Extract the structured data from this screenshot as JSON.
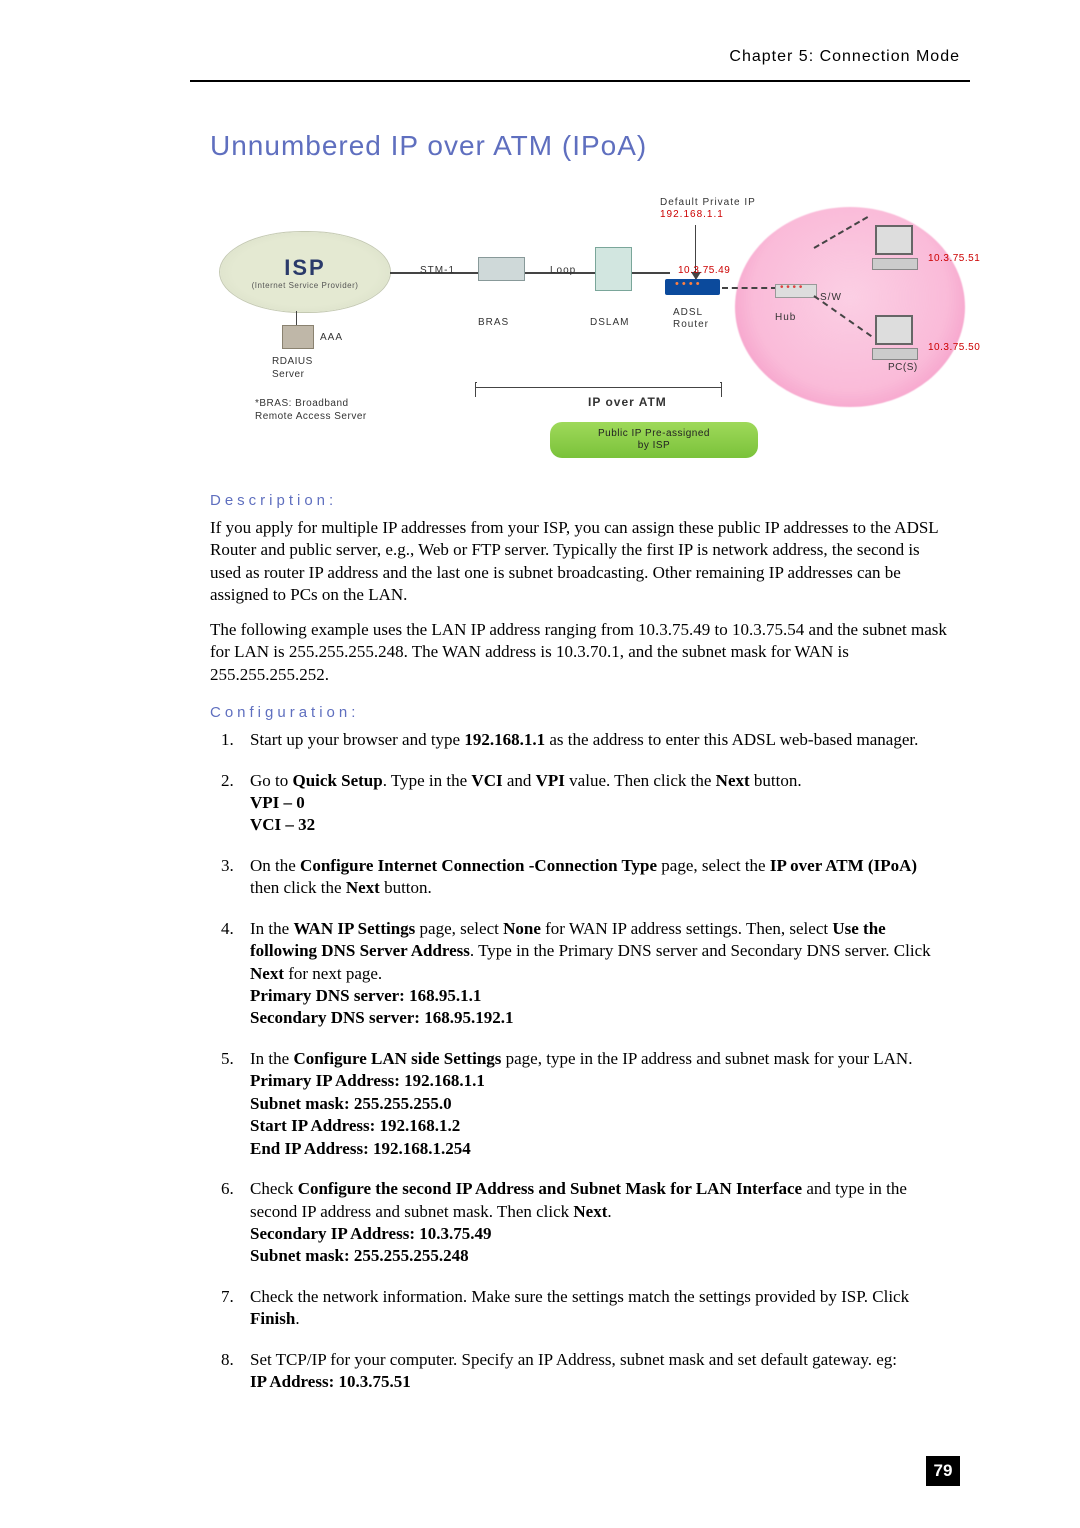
{
  "header": {
    "chapter": "Chapter 5: Connection Mode"
  },
  "title": "Unnumbered IP over ATM (IPoA)",
  "diagram": {
    "isp": "ISP",
    "isp_sub": "(Internet Service Provider)",
    "aaa": "AAA",
    "rdaius": "RDAIUS\nServer",
    "note_bras": "*BRAS: Broadband\nRemote Access Server",
    "stm": "STM-1",
    "bras": "BRAS",
    "loop": "Loop",
    "dslam": "DSLAM",
    "default_ip_label": "Default Private IP",
    "default_ip_value": "192.168.1.1",
    "adsl": "ADSL\nRouter",
    "router_ip": "10.3.75.49",
    "sw": "S/W",
    "hub": "Hub",
    "ip51": "10.3.75.51",
    "ip50": "10.3.75.50",
    "pcs": "PC(S)",
    "ipoa": "IP over ATM",
    "pill": "Public IP Pre-assigned\nby ISP"
  },
  "description": {
    "heading": "Description:",
    "p1": "If you apply for multiple IP addresses from your ISP, you can assign these public IP addresses to the ADSL Router and public server, e.g., Web or FTP server. Typically the first IP is network address, the second is used as router IP address and the last one is subnet broadcasting. Other remaining IP addresses can be assigned to PCs on the LAN.",
    "p2": "The following example uses the LAN IP address ranging from 10.3.75.49 to 10.3.75.54 and the subnet mask for LAN is 255.255.255.248. The WAN address is 10.3.70.1, and the subnet mask for WAN is 255.255.255.252."
  },
  "configuration": {
    "heading": "Configuration:",
    "steps": {
      "s1a": "Start up your browser and type ",
      "s1b": "192.168.1.1",
      "s1c": " as the address to enter this ADSL web-based manager.",
      "s2a": "Go to ",
      "s2b": "Quick Setup",
      "s2c": ". Type in the ",
      "s2d": "VCI",
      "s2e": " and ",
      "s2f": "VPI",
      "s2g": " value. Then click the ",
      "s2h": "Next",
      "s2i": " button.",
      "s2j": "VPI – 0",
      "s2k": "VCI – 32",
      "s3a": "On the ",
      "s3b": "Configure Internet Connection -Connection Type",
      "s3c": " page, select the ",
      "s3d": "IP over ATM (IPoA)",
      "s3e": " then click the ",
      "s3f": "Next",
      "s3g": " button.",
      "s4a": "In the ",
      "s4b": "WAN IP Settings",
      "s4c": " page, select ",
      "s4d": "None",
      "s4e": " for WAN IP address settings. Then, select ",
      "s4f": "Use the following DNS Server Address",
      "s4g": ". Type in the Primary DNS server and Secondary DNS server. Click ",
      "s4h": "Next",
      "s4i": " for next page.",
      "s4j": "Primary DNS server: 168.95.1.1",
      "s4k": "Secondary DNS server: 168.95.192.1",
      "s5a": "In the ",
      "s5b": "Configure LAN side Settings",
      "s5c": " page, type in the IP address and subnet mask for your LAN.",
      "s5d": "Primary IP Address",
      "s5dv": ": 192.168.1.1",
      "s5e": "Subnet mask",
      "s5ev": ": 255.255.255.0",
      "s5f": "Start IP Address: 192.168.1.2",
      "s5g": "End IP Address: 192.168.1.254",
      "s6a": "Check ",
      "s6b": "Configure the second IP Address and Subnet Mask for LAN Interface",
      "s6c": " and type in the second IP address and subnet mask. Then click ",
      "s6d": "Next",
      "s6e": ".",
      "s6f": "Secondary IP Address",
      "s6fv": ": 10.3.75.49",
      "s6g": "Subnet mask",
      "s6gv": ": 255.255.255.248",
      "s7a": "Check the network information. Make sure the settings match the settings provided by ISP. Click ",
      "s7b": "Finish",
      "s7c": ".",
      "s8a": "Set TCP/IP for your computer. Specify an IP Address, subnet mask and set default gateway. eg:",
      "s8b": "IP Address: 10.3.75.51"
    }
  },
  "pagenum": "79"
}
